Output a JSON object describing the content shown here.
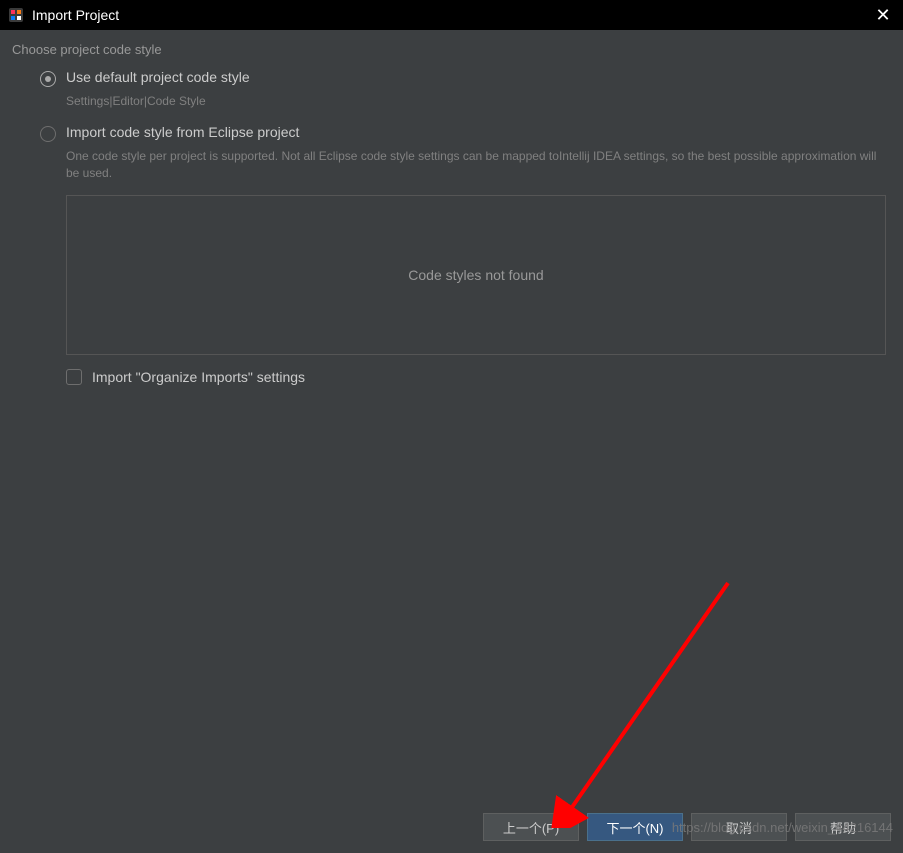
{
  "window": {
    "title": "Import Project"
  },
  "section": {
    "header": "Choose project code style"
  },
  "radio": {
    "option1": {
      "label": "Use default project code style",
      "hint": "Settings|Editor|Code Style"
    },
    "option2": {
      "label": "Import code style from Eclipse project",
      "hint": "One code style per project is supported. Not all Eclipse code style settings can be mapped toIntellij IDEA settings, so the best possible approximation will be used."
    }
  },
  "listbox": {
    "empty_text": "Code styles not found"
  },
  "checkbox": {
    "label": "Import \"Organize Imports\" settings"
  },
  "buttons": {
    "previous": "上一个(P)",
    "next": "下一个(N)",
    "cancel": "取消",
    "help": "帮助"
  },
  "watermark": "https://blog.csdn.net/weixin_44216144"
}
